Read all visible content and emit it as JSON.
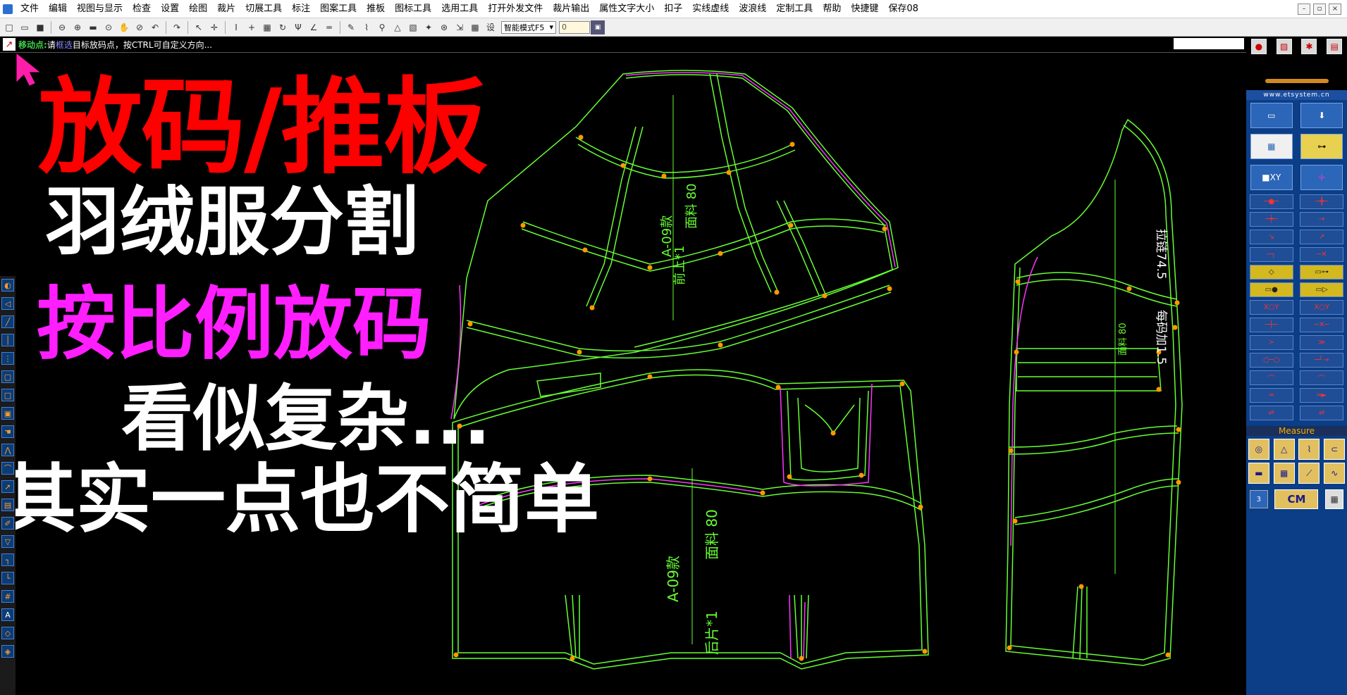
{
  "menubar": {
    "items": [
      "文件",
      "编辑",
      "视图与显示",
      "检查",
      "设置",
      "绘图",
      "裁片",
      "切展工具",
      "标注",
      "图案工具",
      "推板",
      "图标工具",
      "选用工具",
      "打开外发文件",
      "裁片输出",
      "属性文字大小",
      "扣子",
      "实线虚线",
      "波浪线",
      "定制工具",
      "帮助",
      "快捷键",
      "保存08"
    ]
  },
  "toolbar": {
    "mode_select": "智能模式F5",
    "zoom_value": "0",
    "settings_label": "设"
  },
  "statusbar": {
    "label": "移动点:",
    "hint_prefix": "请",
    "hint_highlight": "框选",
    "hint_suffix": "目标放码点，按CTRL可自定义方向..."
  },
  "overlay": {
    "title": "放码/推板",
    "line1": "羽绒服分割",
    "line2": "按比例放码",
    "line3": "看似复杂...",
    "line4": "其实一点也不简单"
  },
  "pattern_labels": {
    "front_style": "A-09款",
    "front_fabric": "面料 80",
    "front_piece": "前上*1",
    "back_style": "A-09款",
    "back_fabric": "面料 80",
    "back_piece": "后片*1",
    "sleeve_note1": "拉链74.5",
    "sleeve_note2": "每码加1.5",
    "small_piece_label": "面料 80"
  },
  "right_panel": {
    "website": "www.etsystem.cn",
    "measure_label": "Measure",
    "unit": "CM",
    "unit_field": "3"
  },
  "colors": {
    "pattern_green": "#66ff33",
    "pattern_white": "#ffffff",
    "pattern_magenta": "#ff33ff",
    "point_orange": "#ff9900",
    "title_red": "#ff0000",
    "overlay_magenta": "#ff1eff",
    "panel_blue": "#0b3e86"
  }
}
